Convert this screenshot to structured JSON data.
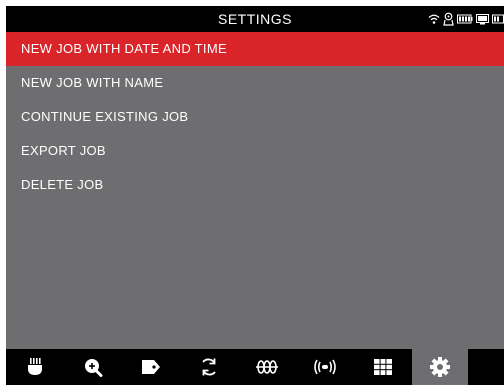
{
  "header": {
    "title": "SETTINGS",
    "status_icons": [
      "wifi-icon",
      "bluetooth-icon",
      "battery-icon",
      "display-icon",
      "battery-small-icon"
    ]
  },
  "menu": {
    "items": [
      {
        "label": "NEW JOB WITH DATE AND TIME",
        "selected": true
      },
      {
        "label": "NEW JOB WITH NAME",
        "selected": false
      },
      {
        "label": "CONTINUE EXISTING JOB",
        "selected": false
      },
      {
        "label": "EXPORT JOB",
        "selected": false
      },
      {
        "label": "DELETE JOB",
        "selected": false
      }
    ]
  },
  "toolbar": {
    "items": [
      {
        "icon": "camera-head-icon",
        "active": false
      },
      {
        "icon": "zoom-in-icon",
        "active": false
      },
      {
        "icon": "tag-icon",
        "active": false
      },
      {
        "icon": "rotate-icon",
        "active": false
      },
      {
        "icon": "sonde-icon",
        "active": false
      },
      {
        "icon": "transmitter-icon",
        "active": false
      },
      {
        "icon": "grid-icon",
        "active": false
      },
      {
        "icon": "settings-gear-icon",
        "active": true
      }
    ]
  },
  "colors": {
    "selected_row": "#d9242a",
    "content_background": "#6e6e70",
    "bar_background": "#000000",
    "text": "#ffffff"
  }
}
